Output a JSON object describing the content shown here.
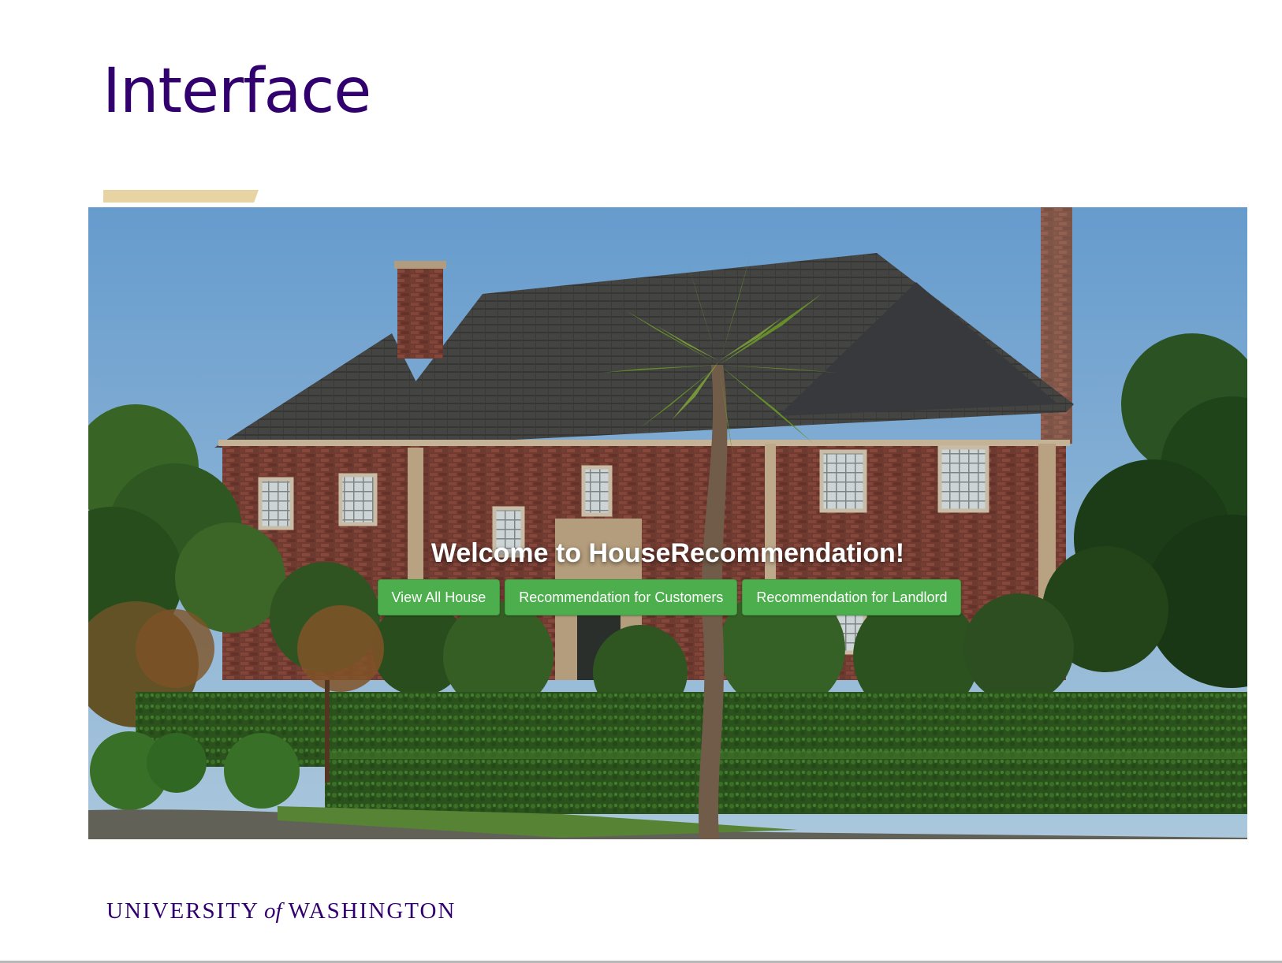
{
  "slide": {
    "title": "Interface",
    "title_color": "#32006e",
    "accent_color": "#e8d3a2"
  },
  "hero": {
    "image_subject": "brick house with palm tree and hedges",
    "welcome_text": "Welcome to HouseRecommendation!",
    "buttons": [
      {
        "label": "View All House"
      },
      {
        "label": "Recommendation for Customers"
      },
      {
        "label": "Recommendation for Landlord"
      }
    ],
    "button_color": "#4cae4c"
  },
  "footer": {
    "logo_part1": "UNIVERSITY",
    "logo_part2": "of",
    "logo_part3": "WASHINGTON"
  }
}
